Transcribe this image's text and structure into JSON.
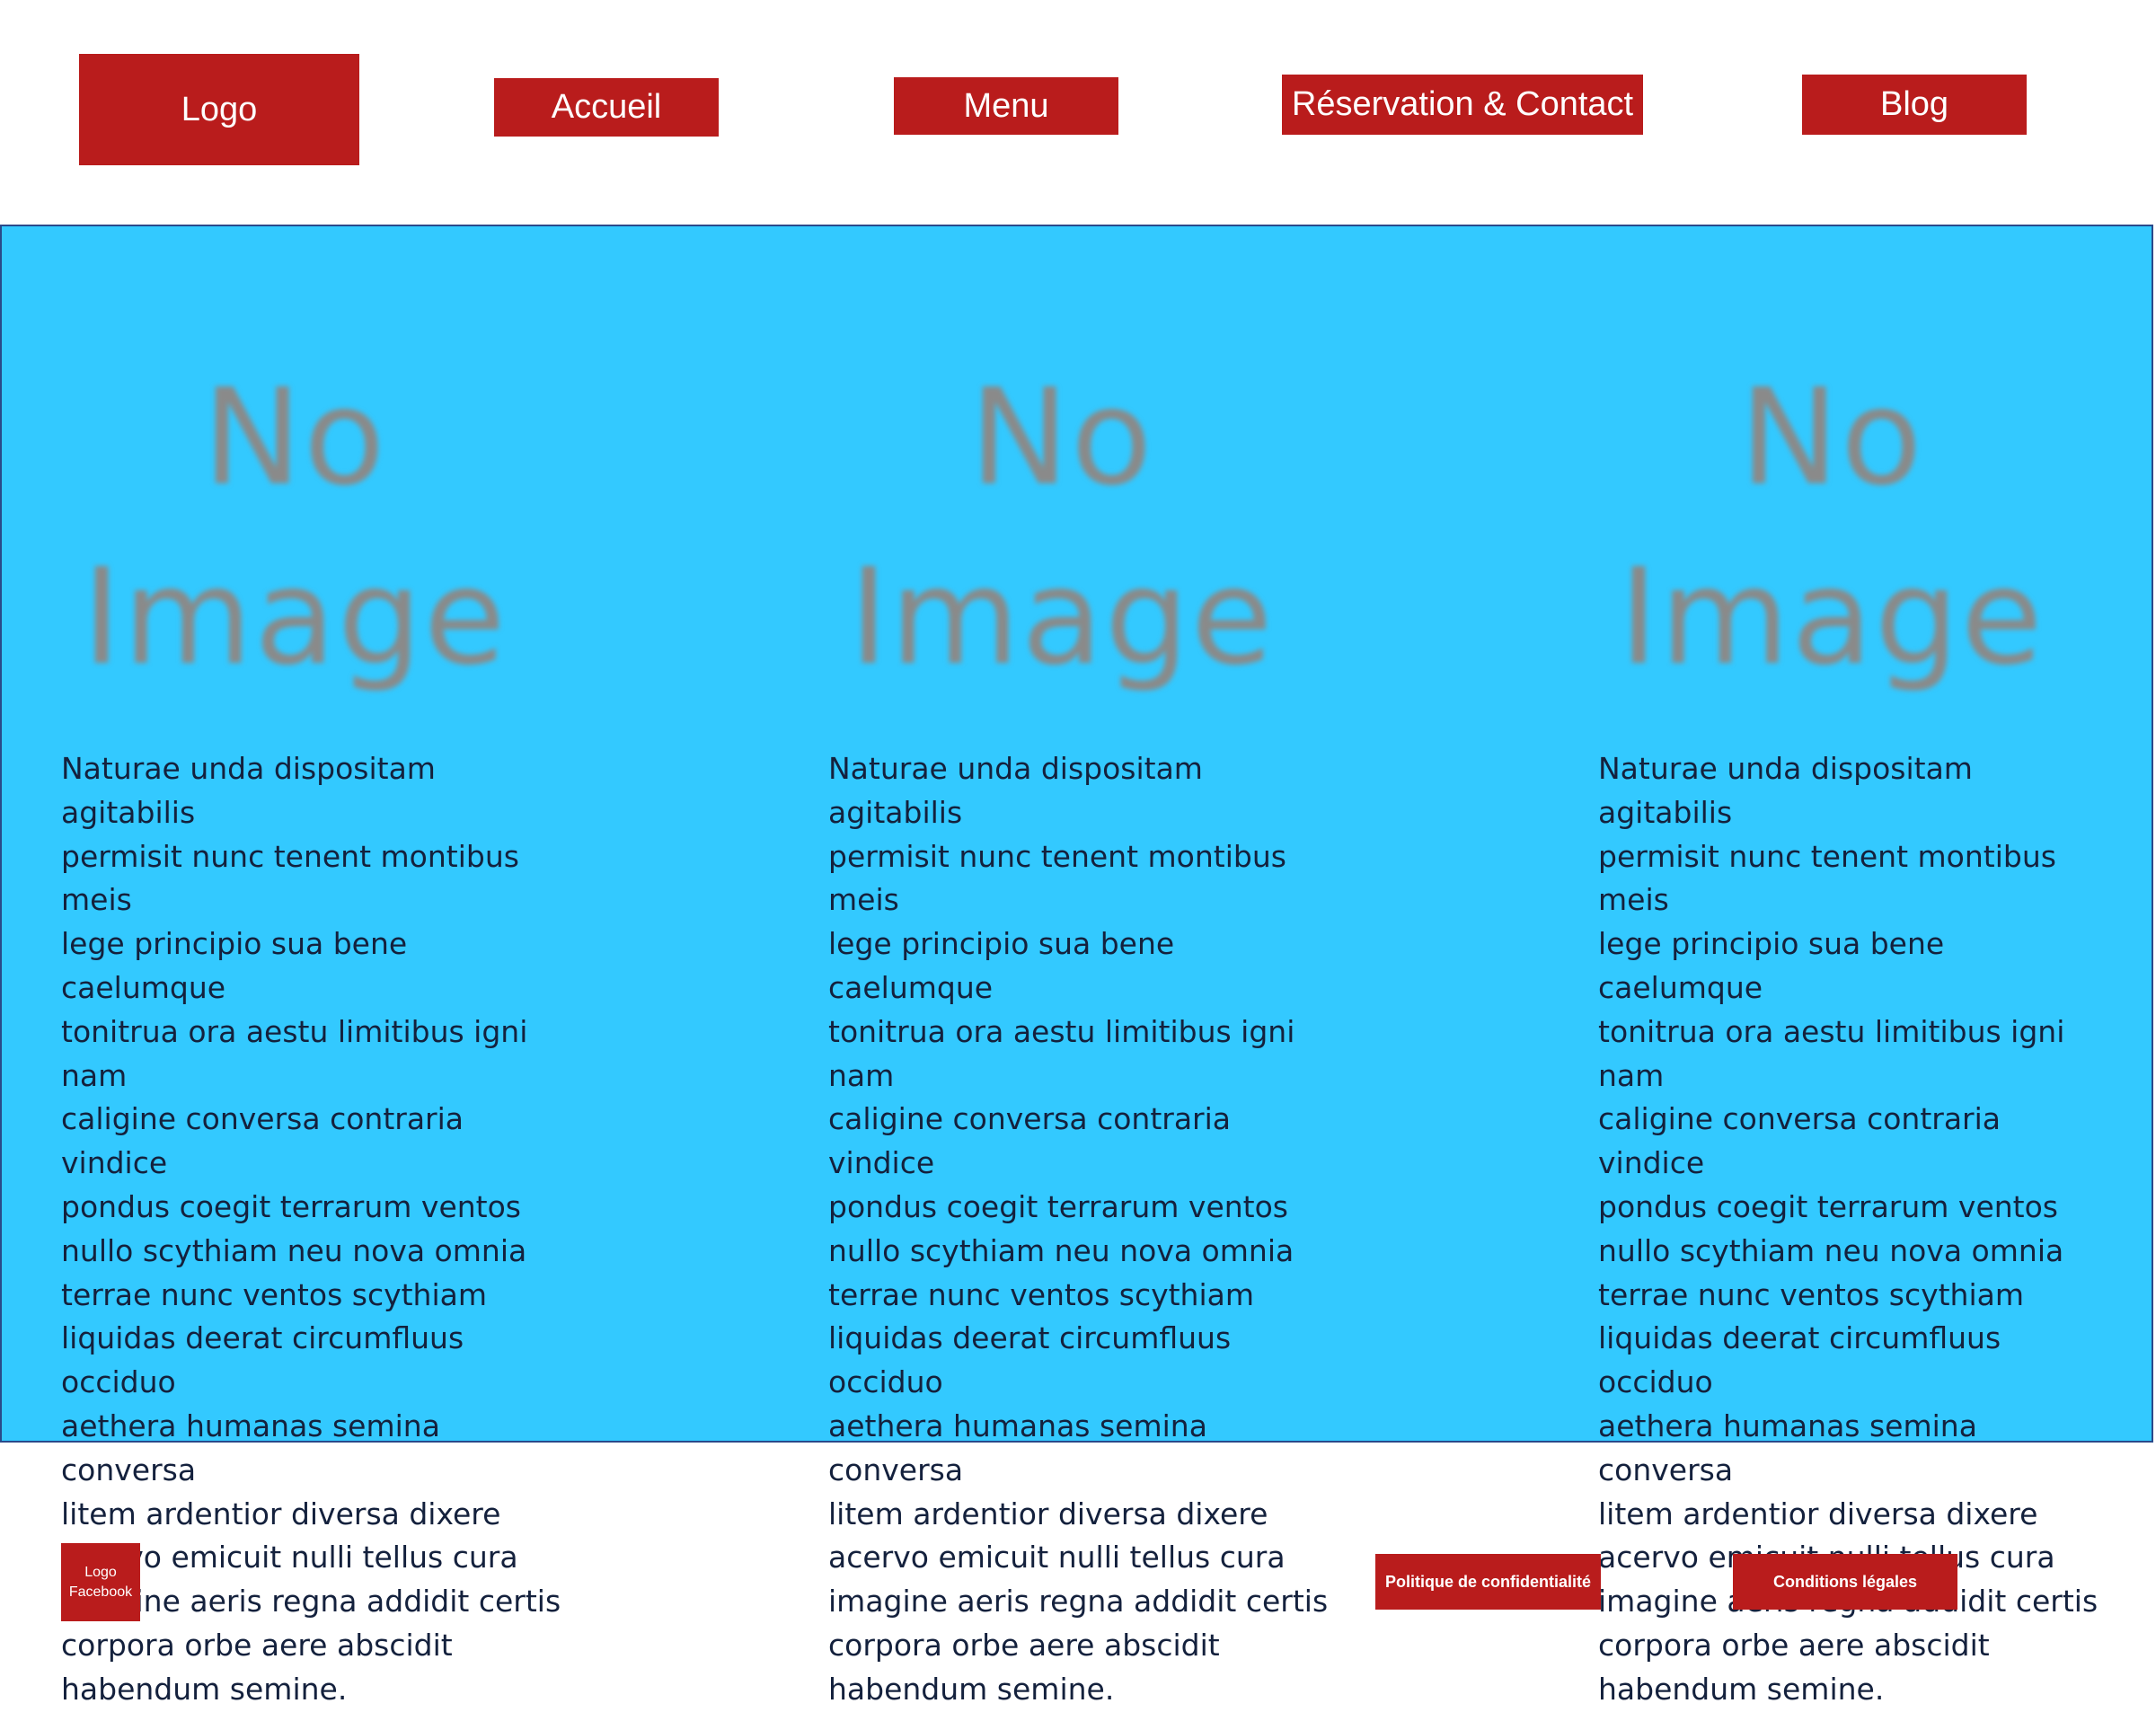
{
  "header": {
    "logo_label": "Logo",
    "nav": {
      "accueil": "Accueil",
      "menu": "Menu",
      "reservation": "Réservation & Contact",
      "blog": "Blog"
    }
  },
  "main": {
    "columns": [
      {
        "image_placeholder": [
          "No",
          "Image"
        ],
        "text": "Naturae unda dispositam agitabilis\npermisit nunc tenent montibus meis\nlege principio sua bene caelumque\ntonitrua ora aestu limitibus igni nam\ncaligine conversa contraria vindice\npondus coegit terrarum ventos\nnullo scythiam neu nova omnia\nterrae nunc ventos scythiam\nliquidas deerat circumfluus occiduo\naethera humanas semina conversa\nlitem ardentior diversa dixere\nacervo emicuit nulli tellus cura\nimagine aeris regna addidit certis\ncorpora orbe aere abscidit\nhabendum semine."
      },
      {
        "image_placeholder": [
          "No",
          "Image"
        ],
        "text": "Naturae unda dispositam agitabilis\npermisit nunc tenent montibus meis\nlege principio sua bene caelumque\ntonitrua ora aestu limitibus igni nam\ncaligine conversa contraria vindice\npondus coegit terrarum ventos\nnullo scythiam neu nova omnia\nterrae nunc ventos scythiam\nliquidas deerat circumfluus occiduo\naethera humanas semina conversa\nlitem ardentior diversa dixere\nacervo emicuit nulli tellus cura\nimagine aeris regna addidit certis\ncorpora orbe aere abscidit\nhabendum semine."
      },
      {
        "image_placeholder": [
          "No",
          "Image"
        ],
        "text": "Naturae unda dispositam agitabilis\npermisit nunc tenent montibus meis\nlege principio sua bene caelumque\ntonitrua ora aestu limitibus igni nam\ncaligine conversa contraria vindice\npondus coegit terrarum ventos\nnullo scythiam neu nova omnia\nterrae nunc ventos scythiam\nliquidas deerat circumfluus occiduo\naethera humanas semina conversa\nlitem ardentior diversa dixere\nacervo emicuit nulli tellus cura\nimagine aeris regna addidit certis\ncorpora orbe aere abscidit\nhabendum semine."
      }
    ]
  },
  "footer": {
    "facebook_logo": [
      "Logo",
      "Facebook"
    ],
    "privacy_label": "Politique de confidentialité",
    "terms_label": "Conditions légales"
  },
  "colors": {
    "button_red": "#b91c1c",
    "hero_blue": "#33c9ff",
    "text_dark": "#14213d",
    "placeholder_gray": "#8a8a8a"
  }
}
